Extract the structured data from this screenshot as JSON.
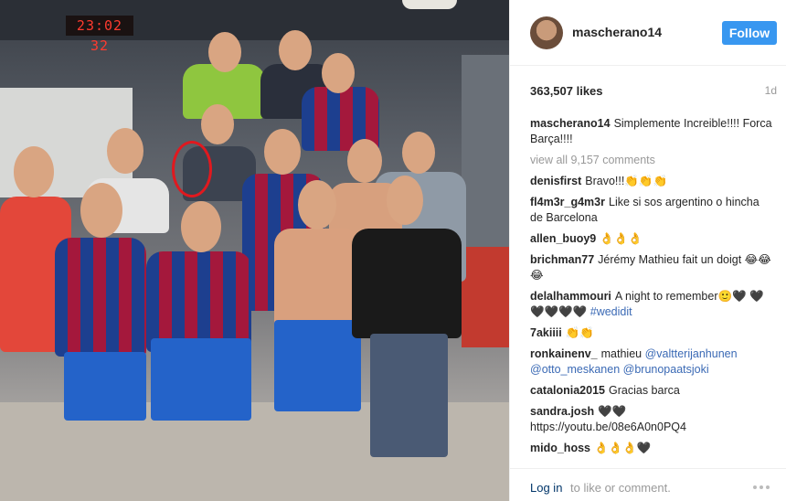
{
  "photo": {
    "clock_text": "23:02 32"
  },
  "header": {
    "username": "mascherano14",
    "follow_label": "Follow"
  },
  "stats": {
    "likes": "363,507 likes",
    "age": "1d"
  },
  "caption": {
    "user": "mascherano14",
    "text": "Simplemente Increible!!!! Forca Barça!!!!"
  },
  "view_all": "view all 9,157 comments",
  "comments": [
    {
      "user": "denisfirst",
      "text": "Bravo!!!👏👏👏"
    },
    {
      "user": "fl4m3r_g4m3r",
      "text": "Like si sos argentino o hincha de Barcelona"
    },
    {
      "user": "allen_buoy9",
      "text": "👌👌👌"
    },
    {
      "user": "brichman77",
      "text": "Jérémy Mathieu fait un doigt 😂😂😂"
    },
    {
      "user": "delalhammouri",
      "text": "A night to remember🙂🖤 🖤🖤🖤🖤🖤",
      "tag": "#wedidit"
    },
    {
      "user": "7akiiii",
      "text": "👏👏"
    },
    {
      "user": "ronkainenv_",
      "text": "mathieu",
      "mentions": "@valtterijanhunen @otto_meskanen @brunopaatsjoki"
    },
    {
      "user": "catalonia2015",
      "text": "Gracias barca"
    },
    {
      "user": "sandra.josh",
      "text": "🖤🖤 https://youtu.be/08e6A0n0PQ4"
    },
    {
      "user": "mido_hoss",
      "text": "👌👌👌🖤"
    }
  ],
  "footer": {
    "login_label": "Log in",
    "login_rest": "to like or comment."
  }
}
